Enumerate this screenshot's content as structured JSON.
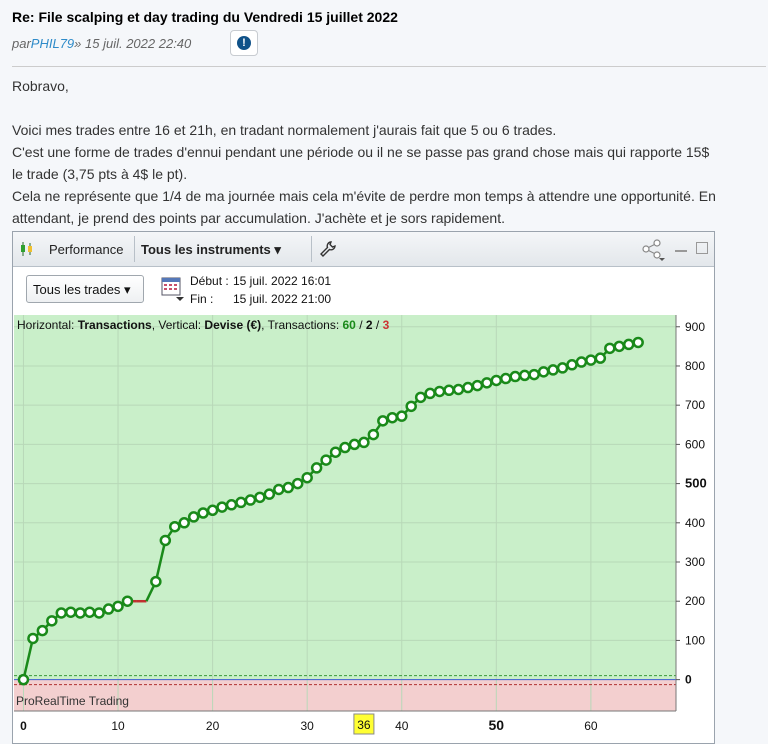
{
  "post": {
    "title": "Re: File scalping et day trading du Vendredi 15 juillet 2022",
    "by_prefix": "par ",
    "author": "PHIL79",
    "date_text": " » 15 juil. 2022 22:40"
  },
  "body": {
    "greeting": "Robravo,",
    "line1": "Voici mes trades entre 16 et 21h, en tradant normalement j'aurais fait que 5 ou 6 trades.",
    "line2": "C'est une forme de trades d'ennui pendant une période ou il ne se passe pas grand chose mais qui rapporte 15$",
    "line3": "le trade (3,75 pts à 4$ le pt).",
    "line4": "Cela ne représente que 1/4 de ma journée mais cela m'évite de perdre mon temps à attendre une opportunité. En",
    "line5": "attendant, je prend des points par accumulation. J'achète et je sors rapidement."
  },
  "window": {
    "title": "Performance",
    "instruments": "Tous les instruments ▾",
    "trades_select": "Tous les trades ▾",
    "start_label": "Début :",
    "start_value": "15 juil. 2022 16:01",
    "end_label": "Fin :",
    "end_value": "15 juil. 2022 21:00",
    "brand": "ProRealTime Trading"
  },
  "legend": {
    "prefix": "Horizontal: ",
    "h_axis": "Transactions",
    "mid": ", Vertical: ",
    "v_axis": "Devise (€)",
    "suffix": ", Transactions: ",
    "total": "60",
    "sep1": " / ",
    "neutral": "2",
    "sep2": " / ",
    "losses": "3"
  },
  "chart_data": {
    "type": "line",
    "xlabel": "Transactions",
    "ylabel": "Devise (€)",
    "xlim": [
      -1,
      69
    ],
    "ylim": [
      -80,
      930
    ],
    "x_ticks": [
      0,
      10,
      20,
      30,
      40,
      50,
      60
    ],
    "y_ticks": [
      0,
      100,
      200,
      300,
      400,
      500,
      600,
      700,
      800,
      900
    ],
    "highlighted_x_tick": "36",
    "colors": {
      "profit": "#1a8a1a",
      "loss": "#c03030",
      "profit_bg": "#c9efc9",
      "loss_bg": "#f3cfcf"
    },
    "x": [
      0,
      1,
      2,
      3,
      4,
      5,
      6,
      7,
      8,
      9,
      10,
      11,
      12,
      13,
      14,
      15,
      16,
      17,
      18,
      19,
      20,
      21,
      22,
      23,
      24,
      25,
      26,
      27,
      28,
      29,
      30,
      31,
      32,
      33,
      34,
      35,
      36,
      37,
      38,
      39,
      40,
      41,
      42,
      43,
      44,
      45,
      46,
      47,
      48,
      49,
      50,
      51,
      52,
      53,
      54,
      55,
      56,
      57,
      58,
      59,
      60,
      61,
      62,
      63,
      64,
      65
    ],
    "values": [
      0,
      105,
      125,
      150,
      170,
      172,
      170,
      172,
      170,
      180,
      187,
      200,
      200,
      200,
      250,
      355,
      390,
      400,
      415,
      425,
      432,
      440,
      446,
      452,
      458,
      465,
      473,
      485,
      490,
      500,
      515,
      540,
      560,
      580,
      592,
      600,
      605,
      625,
      660,
      668,
      672,
      697,
      720,
      730,
      735,
      738,
      740,
      745,
      750,
      757,
      763,
      768,
      773,
      776,
      778,
      785,
      790,
      795,
      803,
      810,
      815,
      820,
      845,
      850,
      855,
      860
    ],
    "markers": [
      1,
      1,
      1,
      1,
      1,
      1,
      1,
      1,
      1,
      1,
      1,
      1,
      0,
      0,
      1,
      1,
      1,
      1,
      1,
      1,
      1,
      1,
      1,
      1,
      1,
      1,
      1,
      1,
      1,
      1,
      1,
      1,
      1,
      1,
      1,
      1,
      1,
      1,
      1,
      1,
      1,
      1,
      1,
      1,
      1,
      1,
      1,
      1,
      1,
      1,
      1,
      1,
      1,
      1,
      1,
      1,
      1,
      1,
      1,
      1,
      1,
      1,
      1,
      1,
      1,
      1
    ]
  }
}
